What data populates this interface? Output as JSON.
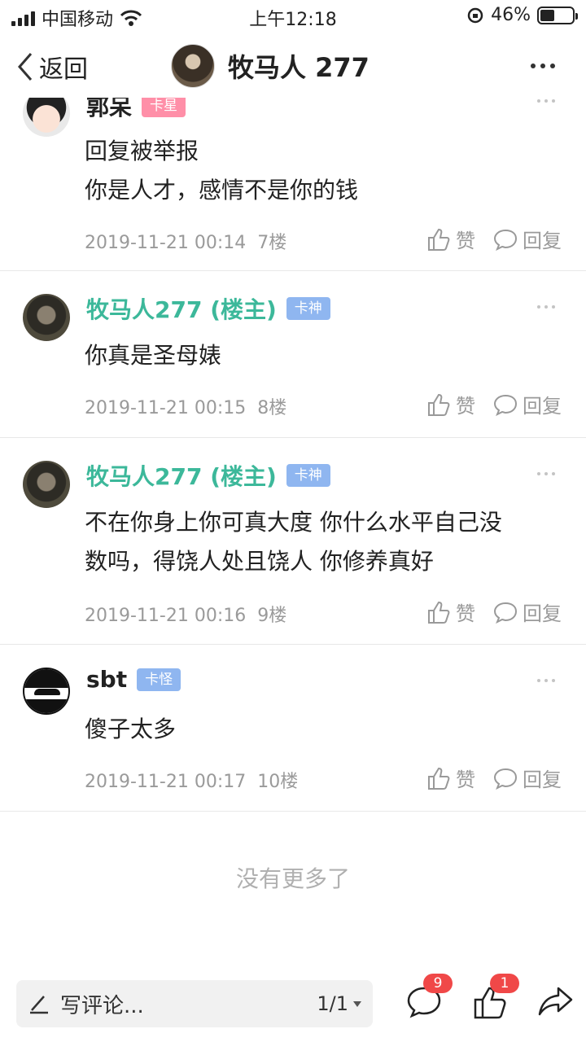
{
  "status_bar": {
    "carrier": "中国移动",
    "time": "上午12:18",
    "battery_percent": "46%",
    "battery_level": 0.46
  },
  "nav": {
    "back_label": "返回",
    "title": "牧马人 277"
  },
  "comments": [
    {
      "username": "郭呆",
      "badge": "卡星",
      "lines": [
        "回复被举报",
        "你是人才，感情不是你的钱"
      ],
      "time": "2019-11-21 00:14",
      "floor": "7楼"
    },
    {
      "username": "牧马人277 (楼主)",
      "badge": "卡神",
      "lines": [
        "你真是圣母婊"
      ],
      "time": "2019-11-21 00:15",
      "floor": "8楼"
    },
    {
      "username": "牧马人277 (楼主)",
      "badge": "卡神",
      "lines": [
        "不在你身上你可真大度 你什么水平自己没",
        "数吗，得饶人处且饶人 你修养真好"
      ],
      "time": "2019-11-21 00:16",
      "floor": "9楼"
    },
    {
      "username": "sbt",
      "badge": "卡怪",
      "lines": [
        "傻子太多"
      ],
      "time": "2019-11-21 00:17",
      "floor": "10楼"
    }
  ],
  "actions": {
    "like_label": "赞",
    "reply_label": "回复"
  },
  "no_more": "没有更多了",
  "bottom_bar": {
    "input_placeholder": "写评论...",
    "pager": "1/1",
    "comment_count": "9",
    "like_count": "1"
  },
  "colors": {
    "op_name": "#3cb89a",
    "badge_blue": "#8fb6f0",
    "badge_pink": "#ff8fa8",
    "red_badge": "#f04848"
  }
}
